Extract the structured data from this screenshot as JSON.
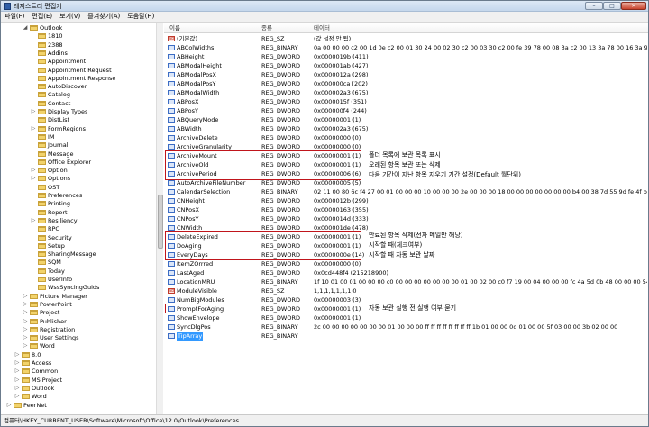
{
  "window": {
    "title": "레지스트리 편집기"
  },
  "menu": [
    "파일(F)",
    "편집(E)",
    "보기(V)",
    "즐겨찾기(A)",
    "도움말(H)"
  ],
  "tree": [
    {
      "label": "Outlook",
      "depth": 4,
      "exp": "-"
    },
    {
      "label": "1810",
      "depth": 5
    },
    {
      "label": "2388",
      "depth": 5
    },
    {
      "label": "Addins",
      "depth": 5
    },
    {
      "label": "Appointment",
      "depth": 5
    },
    {
      "label": "Appointment Request",
      "depth": 5
    },
    {
      "label": "Appointment Response",
      "depth": 5
    },
    {
      "label": "AutoDiscover",
      "depth": 5
    },
    {
      "label": "Catalog",
      "depth": 5
    },
    {
      "label": "Contact",
      "depth": 5
    },
    {
      "label": "Display Types",
      "depth": 5,
      "exp": "+"
    },
    {
      "label": "DistList",
      "depth": 5
    },
    {
      "label": "FormRegions",
      "depth": 5,
      "exp": "+"
    },
    {
      "label": "IM",
      "depth": 5
    },
    {
      "label": "Journal",
      "depth": 5
    },
    {
      "label": "Message",
      "depth": 5
    },
    {
      "label": "Office Explorer",
      "depth": 5
    },
    {
      "label": "Option",
      "depth": 5,
      "exp": "+"
    },
    {
      "label": "Options",
      "depth": 5,
      "exp": "+"
    },
    {
      "label": "OST",
      "depth": 5
    },
    {
      "label": "Preferences",
      "depth": 5
    },
    {
      "label": "Printing",
      "depth": 5
    },
    {
      "label": "Report",
      "depth": 5
    },
    {
      "label": "Resiliency",
      "depth": 5,
      "exp": "+"
    },
    {
      "label": "RPC",
      "depth": 5
    },
    {
      "label": "Security",
      "depth": 5
    },
    {
      "label": "Setup",
      "depth": 5
    },
    {
      "label": "SharingMessage",
      "depth": 5
    },
    {
      "label": "SQM",
      "depth": 5
    },
    {
      "label": "Today",
      "depth": 5
    },
    {
      "label": "UserInfo",
      "depth": 5
    },
    {
      "label": "WssSyncingGuids",
      "depth": 5
    },
    {
      "label": "Picture Manager",
      "depth": 4,
      "exp": "+"
    },
    {
      "label": "PowerPoint",
      "depth": 4,
      "exp": "+"
    },
    {
      "label": "Project",
      "depth": 4,
      "exp": "+"
    },
    {
      "label": "Publisher",
      "depth": 4,
      "exp": "+"
    },
    {
      "label": "Registration",
      "depth": 4,
      "exp": "+"
    },
    {
      "label": "User Settings",
      "depth": 4,
      "exp": "+"
    },
    {
      "label": "Word",
      "depth": 4,
      "exp": "+"
    },
    {
      "label": "8.0",
      "depth": 3,
      "exp": "+"
    },
    {
      "label": "Access",
      "depth": 3,
      "exp": "+"
    },
    {
      "label": "Common",
      "depth": 3,
      "exp": "+"
    },
    {
      "label": "MS Project",
      "depth": 3,
      "exp": "+"
    },
    {
      "label": "Outlook",
      "depth": 3,
      "exp": "+"
    },
    {
      "label": "Word",
      "depth": 3,
      "exp": "+"
    },
    {
      "label": "PeerNet",
      "depth": 2,
      "exp": "+"
    }
  ],
  "list": {
    "headers": {
      "name": "이름",
      "type": "종류",
      "data": "데이터"
    },
    "rows": [
      {
        "icon": "string",
        "name": "(기본값)",
        "type": "REG_SZ",
        "data": "(값 설정 안 됨)"
      },
      {
        "icon": "binary",
        "name": "ABColWidths",
        "type": "REG_BINARY",
        "data": "0a 00 00 00 c2 00 1d 0e c2 00 01 30 24 00 02 30 c2 00 03 30 c2 00 fe 39 78 00 08 3a c2 00 13 3a 78 00 16 3a 96 00 17 3a"
      },
      {
        "icon": "dword",
        "name": "ABHeight",
        "type": "REG_DWORD",
        "data": "0x0000019b (411)"
      },
      {
        "icon": "dword",
        "name": "ABModalHeight",
        "type": "REG_DWORD",
        "data": "0x000001ab (427)"
      },
      {
        "icon": "dword",
        "name": "ABModalPosX",
        "type": "REG_DWORD",
        "data": "0x0000012a (298)"
      },
      {
        "icon": "dword",
        "name": "ABModalPosY",
        "type": "REG_DWORD",
        "data": "0x000000ca (202)"
      },
      {
        "icon": "dword",
        "name": "ABModalWidth",
        "type": "REG_DWORD",
        "data": "0x000002a3 (675)"
      },
      {
        "icon": "dword",
        "name": "ABPosX",
        "type": "REG_DWORD",
        "data": "0x0000015f (351)"
      },
      {
        "icon": "dword",
        "name": "ABPosY",
        "type": "REG_DWORD",
        "data": "0x000000f4 (244)"
      },
      {
        "icon": "dword",
        "name": "ABQueryMode",
        "type": "REG_DWORD",
        "data": "0x00000001 (1)"
      },
      {
        "icon": "dword",
        "name": "ABWidth",
        "type": "REG_DWORD",
        "data": "0x000002a3 (675)"
      },
      {
        "icon": "dword",
        "name": "ArchiveDelete",
        "type": "REG_DWORD",
        "data": "0x00000000 (0)"
      },
      {
        "icon": "dword",
        "name": "ArchiveGranularity",
        "type": "REG_DWORD",
        "data": "0x00000000 (0)"
      },
      {
        "icon": "dword",
        "name": "ArchiveMount",
        "type": "REG_DWORD",
        "data": "0x00000001 (1)"
      },
      {
        "icon": "dword",
        "name": "ArchiveOld",
        "type": "REG_DWORD",
        "data": "0x00000001 (1)"
      },
      {
        "icon": "dword",
        "name": "ArchivePeriod",
        "type": "REG_DWORD",
        "data": "0x00000006 (6)"
      },
      {
        "icon": "dword",
        "name": "AutoArchiveFileNumber",
        "type": "REG_DWORD",
        "data": "0x00000005 (5)"
      },
      {
        "icon": "binary",
        "name": "CalendarSelection",
        "type": "REG_BINARY",
        "data": "02 11 00 80 6c f4 27 00 01 00 00 00 10 00 00 00 2e 00 00 00 18 00 00 00 00 00 00 00 b4 00 38 7d 55 9d fe 4f bc ec ce 60"
      },
      {
        "icon": "dword",
        "name": "CNHeight",
        "type": "REG_DWORD",
        "data": "0x0000012b (299)"
      },
      {
        "icon": "dword",
        "name": "CNPosX",
        "type": "REG_DWORD",
        "data": "0x00000163 (355)"
      },
      {
        "icon": "dword",
        "name": "CNPosY",
        "type": "REG_DWORD",
        "data": "0x0000014d (333)"
      },
      {
        "icon": "dword",
        "name": "CNWidth",
        "type": "REG_DWORD",
        "data": "0x000001de (478)"
      },
      {
        "icon": "dword",
        "name": "DeleteExpired",
        "type": "REG_DWORD",
        "data": "0x00000001 (1)"
      },
      {
        "icon": "dword",
        "name": "DoAging",
        "type": "REG_DWORD",
        "data": "0x00000001 (1)"
      },
      {
        "icon": "dword",
        "name": "EveryDays",
        "type": "REG_DWORD",
        "data": "0x0000000e (14)"
      },
      {
        "icon": "dword",
        "name": "ItemZOrrred",
        "type": "REG_DWORD",
        "data": "0x00000000 (0)"
      },
      {
        "icon": "dword",
        "name": "LastAged",
        "type": "REG_DWORD",
        "data": "0x0cd448f4 (215218900)"
      },
      {
        "icon": "binary",
        "name": "LocationMRU",
        "type": "REG_BINARY",
        "data": "1f 10 01 00 01 00 00 00 c0 00 00 00 00 00 00 00 01 00 02 00 c0 f7 19 00 04 00 00 00 fc 4a 5d 0b 48 00 00 00 54 00 00 00"
      },
      {
        "icon": "string",
        "name": "ModuleVisible",
        "type": "REG_SZ",
        "data": "1,1,1,1,1,1,1,0"
      },
      {
        "icon": "dword",
        "name": "NumBigModules",
        "type": "REG_DWORD",
        "data": "0x00000003 (3)"
      },
      {
        "icon": "dword",
        "name": "PromptForAging",
        "type": "REG_DWORD",
        "data": "0x00000001 (1)"
      },
      {
        "icon": "dword",
        "name": "ShowEnvelope",
        "type": "REG_DWORD",
        "data": "0x00000001 (1)"
      },
      {
        "icon": "binary",
        "name": "SyncDlgPos",
        "type": "REG_BINARY",
        "data": "2c 00 00 00 00 00 00 00 01 00 00 00 ff ff ff ff ff ff ff ff 1b 01 00 00 0d 01 00 00 5f 03 00 00 3b 02 00 00"
      },
      {
        "icon": "dword",
        "name": "TipArray",
        "type": "REG_BINARY",
        "data": "",
        "selected": true
      }
    ]
  },
  "annotations": {
    "archive_mount": "폴더 목록에 보관 목록 표시",
    "archive_old": "오래된 항목 보관 또는 삭제",
    "archive_period": "다음 기간이 지난 항목 지우기 기간 설정(Default 월단위)",
    "delete_expired": "만료된 항목 삭제(전자 메일만 해당)",
    "do_aging": "시작할 때(체크여부)",
    "every_days": "시작할 때 자동 보관 날짜",
    "prompt_for_aging": "자동 보관 실행 전 실행 여부 묻기"
  },
  "status": {
    "path": "컴퓨터\\HKEY_CURRENT_USER\\Software\\Microsoft\\Office\\12.0\\Outlook\\Preferences"
  }
}
